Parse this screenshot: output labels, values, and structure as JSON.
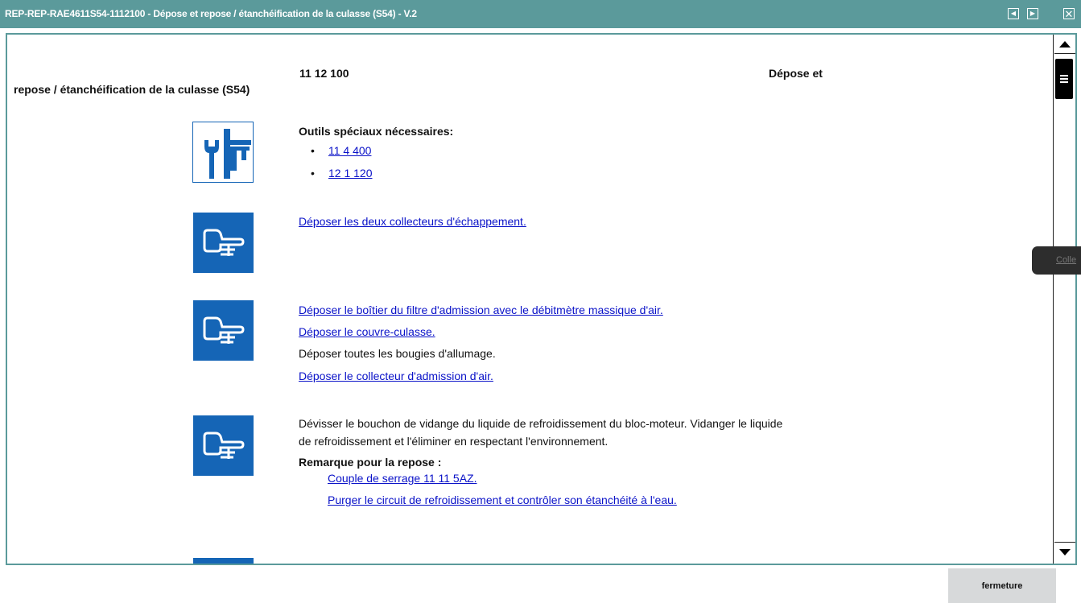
{
  "window": {
    "title": "REP-REP-RAE4611S54-1112100 - Dépose et repose / étanchéification de la culasse (S54) - V.2",
    "prev_icon": "triangle-left-icon",
    "next_icon": "triangle-right-icon",
    "close_icon": "close-x-icon"
  },
  "header": {
    "number": "11 12 100",
    "title_part1": "Dépose et",
    "title_part2": "repose / étanchéification de la culasse (S54)"
  },
  "tools": {
    "title": "Outils spéciaux nécessaires:",
    "items": [
      "11 4 400",
      "12 1 120"
    ]
  },
  "step1": {
    "links": [
      "Déposer les deux collecteurs d'échappement."
    ]
  },
  "step2": {
    "line1": "Déposer le boîtier du filtre d'admission avec le débitmètre massique d'air.",
    "line2": "Déposer le couvre-culasse.",
    "line3": "Déposer toutes les bougies d'allumage.",
    "line4": "Déposer le collecteur d'admission d'air."
  },
  "step3": {
    "text_line1": "Dévisser le bouchon de vidange du liquide de refroidissement du bloc-moteur. Vidanger le liquide",
    "text_line2": "de refroidissement et l'éliminer en respectant l'environnement.",
    "note_title": "Remarque pour la repose :",
    "note_links": [
      "Couple de serrage 11 11 5AZ.",
      "Purger le circuit de refroidissement et contrôler son étanchéité à l'eau."
    ]
  },
  "side_tab": {
    "label": "Colle"
  },
  "footer": {
    "close_label": "fermeture"
  },
  "colors": {
    "titlebar": "#5b9a9b",
    "icon_blue": "#1565b6",
    "link": "#0a12c8",
    "close_button": "#d7d9da"
  }
}
